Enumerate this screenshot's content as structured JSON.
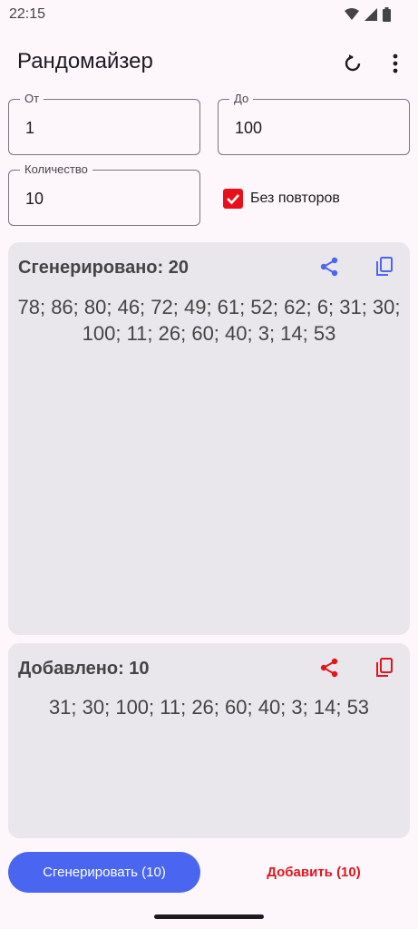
{
  "status_bar": {
    "time": "22:15",
    "icons": [
      "wifi-icon",
      "signal-icon",
      "battery-icon"
    ]
  },
  "app_bar": {
    "title": "Рандомайзер",
    "actions": [
      "refresh-icon",
      "more-vert-icon"
    ]
  },
  "fields": {
    "from": {
      "label": "От",
      "value": "1"
    },
    "to": {
      "label": "До",
      "value": "100"
    },
    "count": {
      "label": "Количество",
      "value": "10"
    }
  },
  "no_repeats": {
    "label": "Без повторов",
    "checked": true,
    "color": "#e8111b"
  },
  "generated_card": {
    "title": "Сгенерировано: 20",
    "numbers": "78; 86; 80; 46; 72; 49; 61; 52; 62; 6; 31; 30; 100; 11; 26; 60; 40; 3; 14; 53",
    "icon_color": "#4a66f0",
    "icons": [
      "share-icon",
      "copy-icon"
    ]
  },
  "added_card": {
    "title": "Добавлено: 10",
    "numbers": "31; 30; 100; 11; 26; 60; 40; 3; 14; 53",
    "icon_color": "#e0161e",
    "icons": [
      "share-icon",
      "copy-icon"
    ]
  },
  "buttons": {
    "generate": "Сгенерировать (10)",
    "add": "Добавить (10)"
  },
  "colors": {
    "background": "#fdf7fb",
    "primary": "#4a66f0",
    "accent": "#e0161e",
    "card": "#eae7ec"
  }
}
